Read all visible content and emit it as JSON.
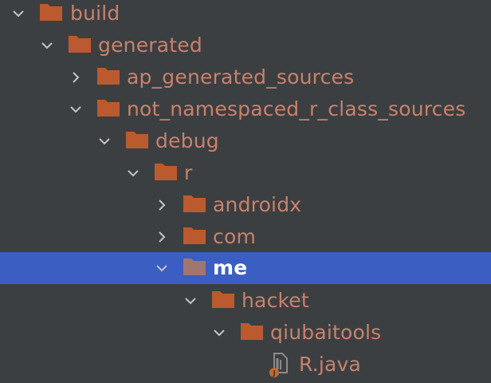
{
  "colors": {
    "background": "#3c3f41",
    "selection": "#3b5ec2",
    "folder": "#bb5a2e",
    "folder_selected": "#a0766f",
    "label": "#c7826c",
    "label_selected": "#ffffff",
    "chevron": "#c4c4c4"
  },
  "tree": {
    "nodes": [
      {
        "label": "build",
        "icon": "folder-icon",
        "state": "expanded"
      },
      {
        "label": "generated",
        "icon": "folder-icon",
        "state": "expanded"
      },
      {
        "label": "ap_generated_sources",
        "icon": "folder-icon",
        "state": "collapsed"
      },
      {
        "label": "not_namespaced_r_class_sources",
        "icon": "folder-icon",
        "state": "expanded"
      },
      {
        "label": "debug",
        "icon": "folder-icon",
        "state": "expanded"
      },
      {
        "label": "r",
        "icon": "folder-icon",
        "state": "expanded"
      },
      {
        "label": "androidx",
        "icon": "folder-icon",
        "state": "collapsed"
      },
      {
        "label": "com",
        "icon": "folder-icon",
        "state": "collapsed"
      },
      {
        "label": "me",
        "icon": "folder-icon",
        "state": "expanded",
        "selected": true
      },
      {
        "label": "hacket",
        "icon": "folder-icon",
        "state": "expanded"
      },
      {
        "label": "qiubaitools",
        "icon": "folder-icon",
        "state": "expanded"
      },
      {
        "label": "R.java",
        "icon": "java-file-icon",
        "state": "leaf"
      }
    ]
  }
}
